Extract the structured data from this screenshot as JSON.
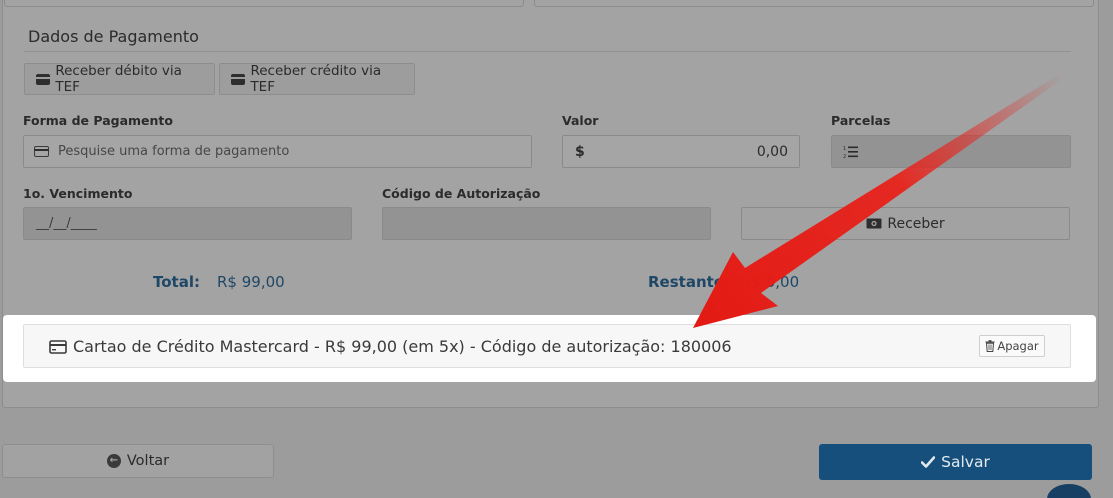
{
  "section": {
    "title": "Dados de Pagamento"
  },
  "tef": {
    "debit_label": "Receber débito via TEF",
    "credit_label": "Receber crédito via TEF"
  },
  "form": {
    "forma_pagamento": {
      "label": "Forma de Pagamento",
      "placeholder": "Pesquise uma forma de pagamento"
    },
    "valor": {
      "label": "Valor",
      "currency": "$",
      "value": "0,00"
    },
    "parcelas": {
      "label": "Parcelas",
      "value": ""
    },
    "vencimento": {
      "label": "1o. Vencimento",
      "placeholder": "__/__/____"
    },
    "codigo_autorizacao": {
      "label": "Código de Autorização",
      "value": ""
    },
    "receber_label": "Receber"
  },
  "totals": {
    "total_label": "Total:",
    "total_value": "R$ 99,00",
    "restante_label": "Restante:",
    "restante_value": "R$ 0,00"
  },
  "payments": [
    {
      "text": "Cartao de Crédito Mastercard - R$ 99,00 (em 5x) - Código de autorização: 180006",
      "delete_label": "Apagar",
      "icon": "credit-card-icon"
    }
  ],
  "footer": {
    "back_label": "Voltar",
    "save_label": "Salvar"
  },
  "colors": {
    "overlay": "#9c9c9c",
    "highlight": "#ffffff",
    "arrow": "#e8221b",
    "save_button": "#164f7c",
    "total_text": "#1e4766"
  }
}
